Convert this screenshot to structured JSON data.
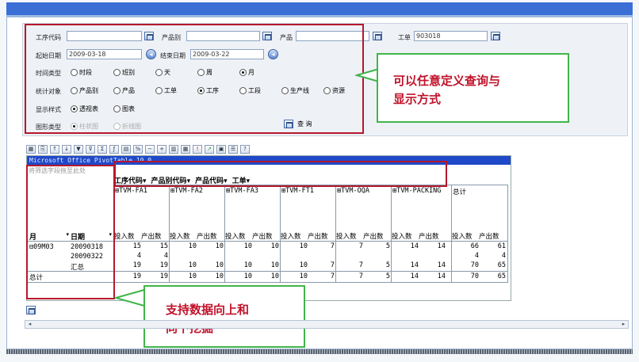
{
  "form": {
    "proc_code_label": "工序代码",
    "product_cat_label": "产品别",
    "product_label": "产品",
    "workorder_label": "工单",
    "workorder_value": "903018",
    "start_label": "起始日期",
    "start_value": "2009-03-18",
    "end_label": "结束日期",
    "end_value": "2009-03-22",
    "time_type_label": "时间类型",
    "time_options": [
      "时段",
      "班别",
      "天",
      "周",
      "月"
    ],
    "stat_label": "统计对象",
    "stat_options": [
      "产品别",
      "产品",
      "工单",
      "工序",
      "工段",
      "生产线",
      "资源"
    ],
    "display_label": "显示样式",
    "display_options": [
      "透视表",
      "图表"
    ],
    "chart_type_label": "图形类型",
    "chart_options": [
      "柱状图",
      "折线图"
    ],
    "query_label": "查 询"
  },
  "callout_top": {
    "line1": "可以任意定义查询与",
    "line2": "显示方式"
  },
  "callout_bottom": {
    "line1": "支持数据向上和",
    "line2": "向下挖掘"
  },
  "pivot": {
    "title": "Microsoft Office PivotTable 10.0",
    "filter_zone": "将筛选字段拖至此处",
    "column_fields": [
      "工序代码",
      "产品别代码",
      "产品代码",
      "工单"
    ],
    "row_fields": [
      "月",
      "日期"
    ],
    "groups": [
      "TVM-FA1",
      "TVM-FA2",
      "TVM-FA3",
      "TVM-FT1",
      "TVM-OQA",
      "TVM-PACKING",
      "总计"
    ],
    "measures": [
      "投入数",
      "产出数"
    ],
    "rows": [
      {
        "month": "09M03",
        "date": "20090318",
        "values": [
          "15",
          "15",
          "10",
          "10",
          "10",
          "10",
          "10",
          "7",
          "7",
          "5",
          "14",
          "14",
          "66",
          "61"
        ]
      },
      {
        "month": "",
        "date": "20090322",
        "values": [
          "4",
          "4",
          "",
          "",
          "",
          "",
          "",
          "",
          "",
          "",
          "",
          "",
          "4",
          "4"
        ]
      },
      {
        "month": "",
        "date": "汇总",
        "values": [
          "19",
          "19",
          "10",
          "10",
          "10",
          "10",
          "10",
          "7",
          "7",
          "5",
          "14",
          "14",
          "70",
          "65"
        ]
      }
    ],
    "total_label": "总计",
    "total_values": [
      "19",
      "19",
      "10",
      "10",
      "10",
      "10",
      "10",
      "7",
      "7",
      "5",
      "14",
      "14",
      "70",
      "65"
    ]
  }
}
